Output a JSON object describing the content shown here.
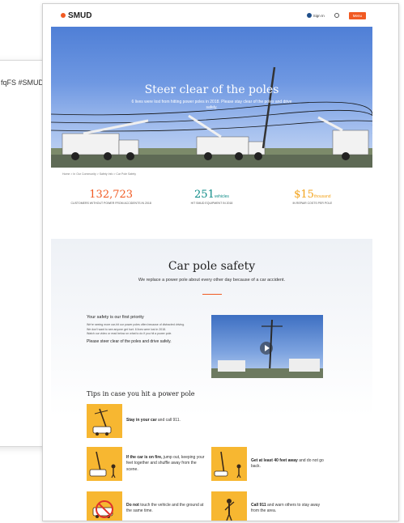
{
  "tweet": {
    "text": "fqFS #SMUD"
  },
  "header": {
    "logo": "SMUD",
    "signin": "Sign In",
    "menu": "Menu"
  },
  "hero": {
    "title": "Steer clear of the poles",
    "subtitle": "6 lives were lost from hitting power poles in 2018. Please stay clear of the poles and drive safely."
  },
  "breadcrumbs": "Home  >  In Our Community  >  Safety Info  >  Car Pole Safety",
  "stats": [
    {
      "number": "132,723",
      "unit": "",
      "caption": "Customers without power from accidents in 2018"
    },
    {
      "number": "251",
      "unit": "vehicles",
      "caption": "Hit SMUD equipment in 2018"
    },
    {
      "number": "$15",
      "unit": "thousand",
      "caption": "In repair costs per pole"
    }
  ],
  "section": {
    "title": "Car pole safety",
    "lead": "We replace a power pole about every other day because of a car accident."
  },
  "priority": {
    "heading": "Your safety is our first priority",
    "line1": "We're seeing more car-hit our power poles often because of distracted driving.",
    "line2": "We don't want to see anyone get hurt. 6 lives were lost in 2018.",
    "line3": "Watch our video or read below on what to do if you hit a power pole.",
    "emphasis": "Please steer clear of the poles and drive safely."
  },
  "tips": {
    "title": "Tips in case you hit a power pole",
    "items": [
      {
        "bold": "Stay in your car",
        "rest": " and call 911."
      },
      {
        "bold": "If the car is on fire,",
        "rest": " jump out, keeping your feet together and shuffle away from the scene."
      },
      {
        "bold": "Get at least 40 feet away",
        "rest": " and do not go back."
      },
      {
        "bold": "Do not",
        "rest": " touch the vehicle and the ground at the same time."
      },
      {
        "bold": "Call 911",
        "rest": " and warn others to stay away from the area."
      }
    ]
  },
  "colors": {
    "brand": "#f15a22",
    "teal": "#0d8b87",
    "gold": "#f3a31b",
    "tipYellow": "#f7b731"
  }
}
